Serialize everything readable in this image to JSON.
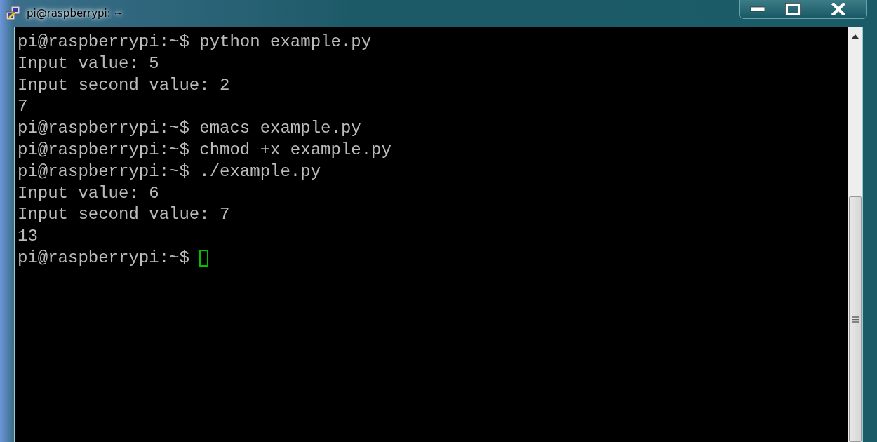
{
  "window": {
    "title": "pi@raspberrypi: ~"
  },
  "terminal": {
    "lines": [
      {
        "text": "pi@raspberrypi:~$ python example.py"
      },
      {
        "text": "Input value: 5"
      },
      {
        "text": "Input second value: 2"
      },
      {
        "text": "7"
      },
      {
        "text": "pi@raspberrypi:~$ emacs example.py"
      },
      {
        "text": "pi@raspberrypi:~$ chmod +x example.py"
      },
      {
        "text": "pi@raspberrypi:~$ ./example.py"
      },
      {
        "text": "Input value: 6"
      },
      {
        "text": "Input second value: 7"
      },
      {
        "text": "13"
      },
      {
        "text": "pi@raspberrypi:~$ "
      }
    ],
    "cursor_visible": true
  }
}
